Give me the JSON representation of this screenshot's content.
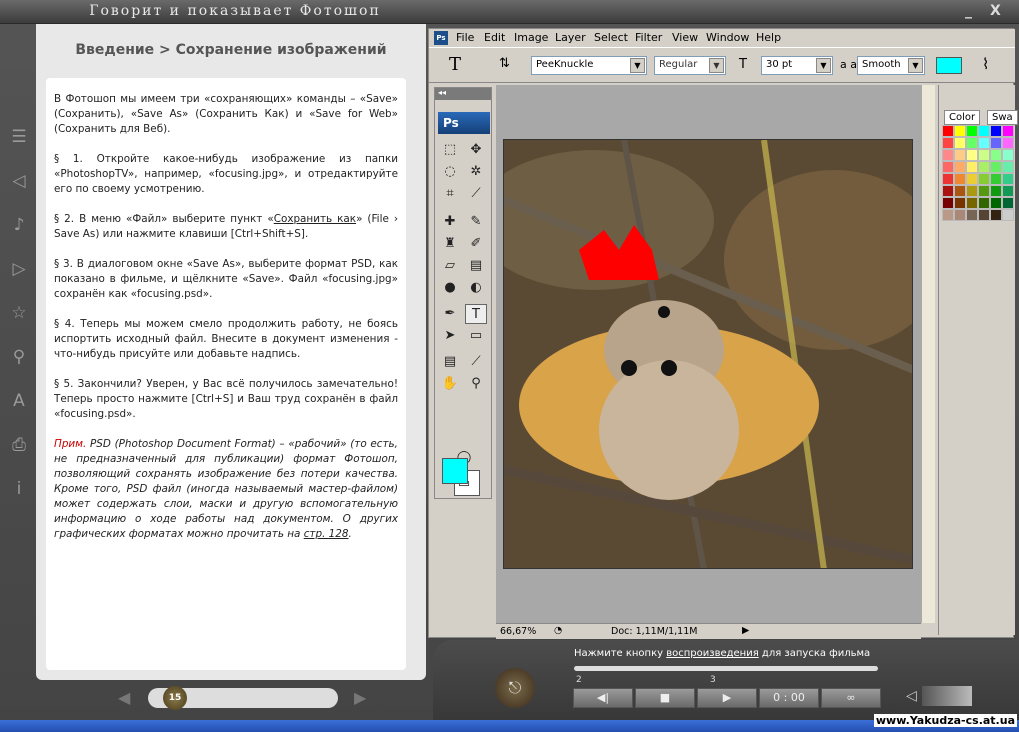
{
  "app": {
    "title": "Говорит и показывает Фотошоп",
    "minimize": "_",
    "close": "X"
  },
  "lesson": {
    "breadcrumb": "Введение >  Сохранение изображений",
    "paragraphs": [
      "В Фотошоп мы имеем три «сохраняющих» команды – «Save» (Сохранить), «Save As» (Сохранить Как) и «Save for Web» (Сохранить для Веб).",
      "§ 1. Откройте какое-нибудь изображение из папки «PhotoshopTV», например, «focusing.jpg», и отредактируйте его по своему усмотрению.",
      "§ 3. В диалоговом окне «Save As», выберите формат PSD, как показано в фильме, и щёлкните «Save». Файл «focusing.jpg» сохранён как «focusing.psd».",
      "§ 4. Теперь мы можем смело продолжить работу, не боясь испортить исходный файл. Внесите в документ изменения - что-нибудь присуйте или добавьте надпись.",
      "§ 5. Закончили? Уверен, у Вас всё получилось замечательно! Теперь просто нажмите [Ctrl+S] и Ваш труд сохранён в файл «focusing.psd»."
    ],
    "p2_a": "§ 2. В меню «Файл» выберите пункт «",
    "p2_link": "Сохранить как",
    "p2_b": "» (File › Save As) или нажмите клавиши [Ctrl+Shift+S].",
    "note_label": "Прим.",
    "note_text": " PSD (Photoshop Document Format) – «рабочий» (то есть, не предназначенный для публикации) формат Фотошоп, позволяющий сохранять изображение без потери качества. Кроме того, PSD файл (иногда называемый мастер-файлом) может содержать слои, маски и другую вспомогательную информацию о ходе работы над документом. О других графических форматах можно прочитать на ",
    "note_link": "стр. 128",
    "note_end": "."
  },
  "photoshop": {
    "menu": [
      "File",
      "Edit",
      "Image",
      "Layer",
      "Select",
      "Filter",
      "View",
      "Window",
      "Help"
    ],
    "font_family": "PeeKnuckle",
    "font_style": "Regular",
    "font_size": "30 pt",
    "aa_label": "a a",
    "antialias": "Smooth",
    "fg_color": "#00ffff",
    "zoom": "66,67%",
    "doc": "Doc: 1,11M/1,11M",
    "logo": "Ps",
    "panel_tabs": [
      "Color",
      "Swa"
    ]
  },
  "player": {
    "hint_a": "Нажмите кнопку ",
    "hint_link": "воспроизведения",
    "hint_b": " для запуска фильма",
    "page": "15",
    "time": "0 : 00",
    "marker2": "2",
    "marker3": "3"
  },
  "watermark": "www.Yakudza-cs.at.ua"
}
